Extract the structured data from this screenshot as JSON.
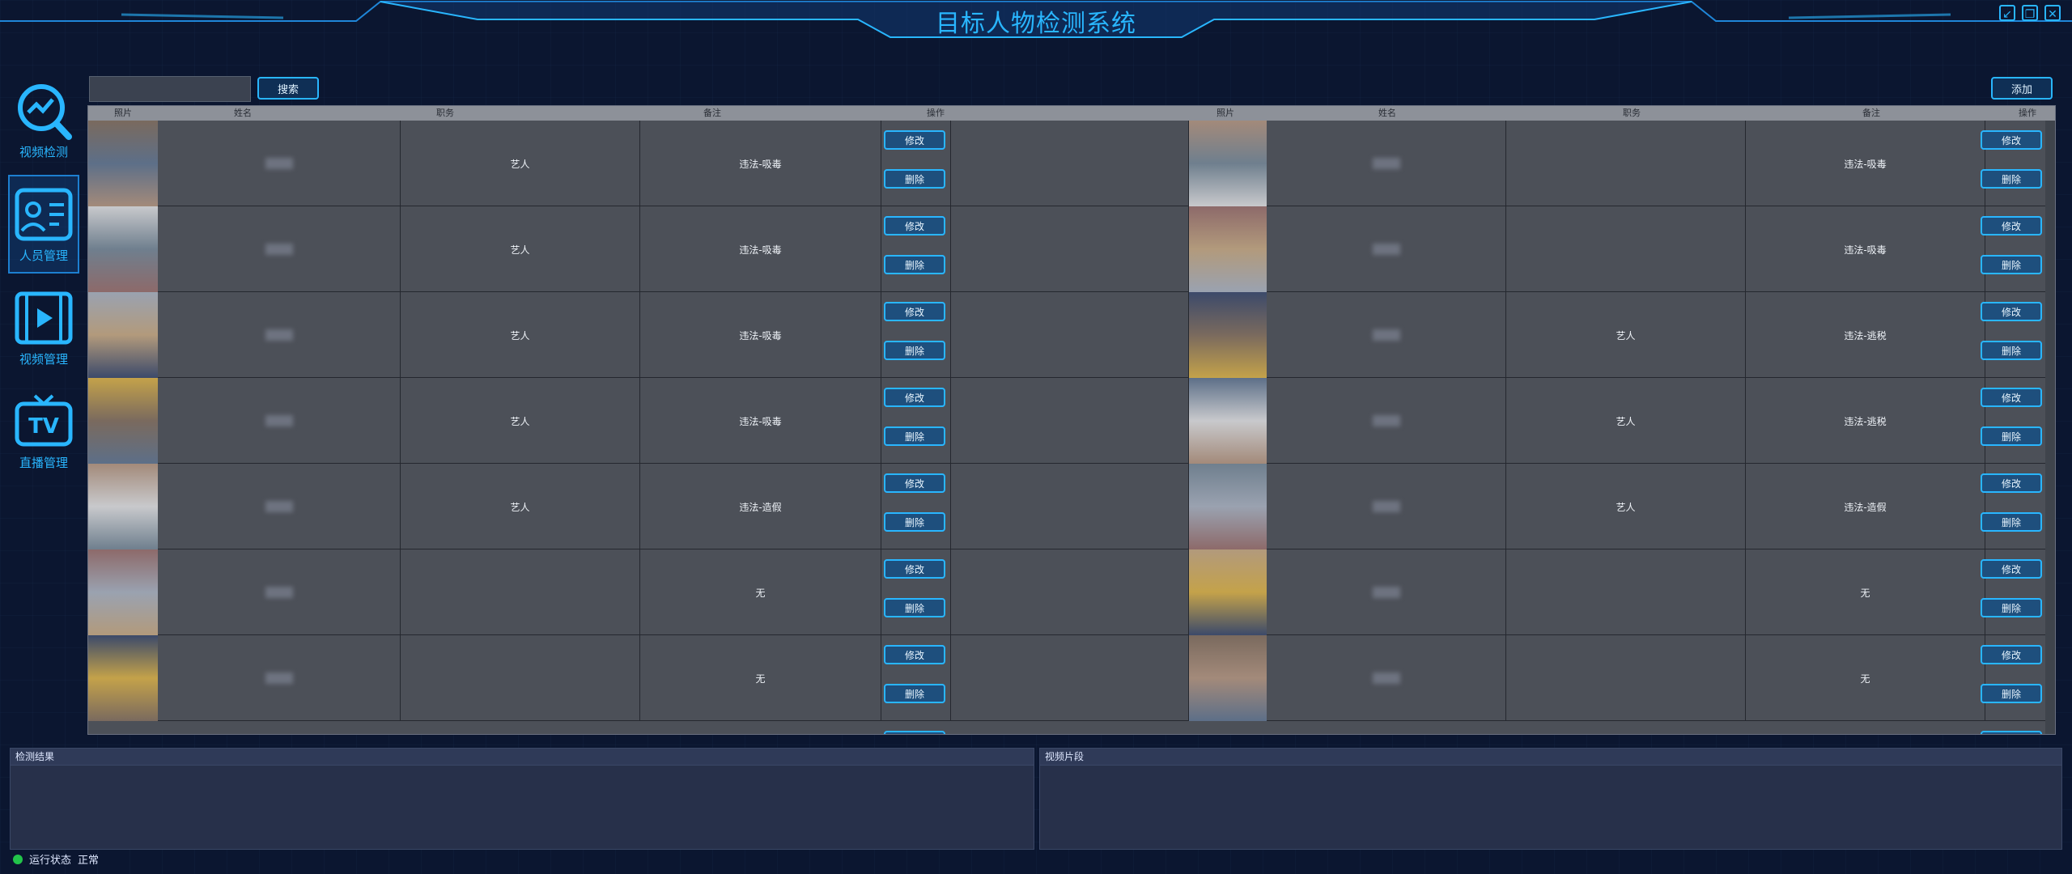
{
  "app": {
    "title": "目标人物检测系统"
  },
  "window_controls": [
    "minimize-icon",
    "maximize-icon",
    "close-icon"
  ],
  "sidebar": {
    "items": [
      {
        "label": "视频检测",
        "icon": "chart-search-icon",
        "active": false
      },
      {
        "label": "人员管理",
        "icon": "person-card-icon",
        "active": true
      },
      {
        "label": "视频管理",
        "icon": "video-play-icon",
        "active": false
      },
      {
        "label": "直播管理",
        "icon": "tv-icon",
        "active": false
      }
    ]
  },
  "toolbar": {
    "search_value": "",
    "search_label": "搜索",
    "add_label": "添加"
  },
  "table": {
    "columns": [
      "照片",
      "姓名",
      "职务",
      "备注",
      "操作"
    ],
    "edit_label": "修改",
    "delete_label": "删除",
    "left_rows": [
      {
        "title": "艺人",
        "note": "违法-吸毒"
      },
      {
        "title": "艺人",
        "note": "违法-吸毒"
      },
      {
        "title": "艺人",
        "note": "违法-吸毒"
      },
      {
        "title": "艺人",
        "note": "违法-吸毒"
      },
      {
        "title": "艺人",
        "note": "违法-造假"
      },
      {
        "title": "",
        "note": "无"
      },
      {
        "title": "",
        "note": "无"
      }
    ],
    "right_rows": [
      {
        "title": "",
        "note": "违法-吸毒"
      },
      {
        "title": "",
        "note": "违法-吸毒"
      },
      {
        "title": "艺人",
        "note": "违法-逃税"
      },
      {
        "title": "艺人",
        "note": "违法-逃税"
      },
      {
        "title": "艺人",
        "note": "违法-造假"
      },
      {
        "title": "",
        "note": "无"
      },
      {
        "title": "",
        "note": "无"
      }
    ]
  },
  "panels": {
    "detect_result": "检测结果",
    "video_clip": "视频片段"
  },
  "status": {
    "label": "运行状态",
    "value": "正常",
    "color": "#22c44a"
  },
  "colors": {
    "accent": "#29b6ff",
    "background": "#0b1630",
    "table_bg": "#4c5058"
  }
}
